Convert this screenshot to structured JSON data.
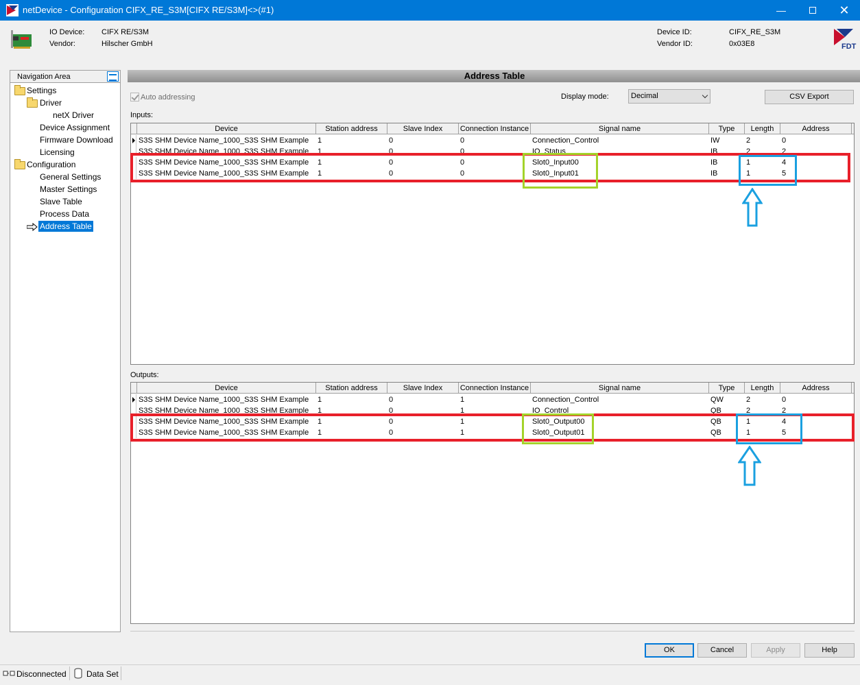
{
  "window": {
    "title": "netDevice - Configuration CIFX_RE_S3M[CIFX RE/S3M]<>(#1)"
  },
  "header": {
    "io_device_label": "IO Device:",
    "io_device_value": "CIFX RE/S3M",
    "vendor_label": "Vendor:",
    "vendor_value": "Hilscher GmbH",
    "device_id_label": "Device ID:",
    "device_id_value": "CIFX_RE_S3M",
    "vendor_id_label": "Vendor ID:",
    "vendor_id_value": "0x03E8",
    "logo_text": "FDT"
  },
  "nav": {
    "title": "Navigation Area",
    "items": [
      "Settings",
      "Driver",
      "netX Driver",
      "Device Assignment",
      "Firmware Download",
      "Licensing",
      "Configuration",
      "General Settings",
      "Master Settings",
      "Slave Table",
      "Process Data",
      "Address Table"
    ],
    "selected": "Address Table"
  },
  "main": {
    "title": "Address Table",
    "auto_addressing": "Auto addressing",
    "display_mode_label": "Display mode:",
    "display_mode_value": "Decimal",
    "csv_export": "CSV Export",
    "inputs_label": "Inputs:",
    "outputs_label": "Outputs:"
  },
  "columns": [
    "Device",
    "Station address",
    "Slave Index",
    "Connection Instance",
    "Signal name",
    "Type",
    "Length",
    "Address"
  ],
  "inputs": [
    [
      "S3S SHM Device Name_1000_S3S SHM Example",
      "1",
      "0",
      "0",
      "Connection_Control",
      "IW",
      "2",
      "0"
    ],
    [
      "S3S SHM Device Name_1000_S3S SHM Example",
      "1",
      "0",
      "0",
      "IO_Status",
      "IB",
      "2",
      "2"
    ],
    [
      "S3S SHM Device Name_1000_S3S SHM Example",
      "1",
      "0",
      "0",
      "Slot0_Input00",
      "IB",
      "1",
      "4"
    ],
    [
      "S3S SHM Device Name_1000_S3S SHM Example",
      "1",
      "0",
      "0",
      "Slot0_Input01",
      "IB",
      "1",
      "5"
    ]
  ],
  "outputs": [
    [
      "S3S SHM Device Name_1000_S3S SHM Example",
      "1",
      "0",
      "1",
      "Connection_Control",
      "QW",
      "2",
      "0"
    ],
    [
      "S3S SHM Device Name_1000_S3S SHM Example",
      "1",
      "0",
      "1",
      "IO_Control",
      "QB",
      "2",
      "2"
    ],
    [
      "S3S SHM Device Name_1000_S3S SHM Example",
      "1",
      "0",
      "1",
      "Slot0_Output00",
      "QB",
      "1",
      "4"
    ],
    [
      "S3S SHM Device Name_1000_S3S SHM Example",
      "1",
      "0",
      "1",
      "Slot0_Output01",
      "QB",
      "1",
      "5"
    ]
  ],
  "buttons": {
    "ok": "OK",
    "cancel": "Cancel",
    "apply": "Apply",
    "help": "Help"
  },
  "status": {
    "connection": "Disconnected",
    "dataset": "Data Set"
  },
  "colors": {
    "titlebar": "#0078d7",
    "highlight_red": "#e8202a",
    "highlight_green": "#a4d32a",
    "highlight_blue": "#1aa0e0"
  }
}
